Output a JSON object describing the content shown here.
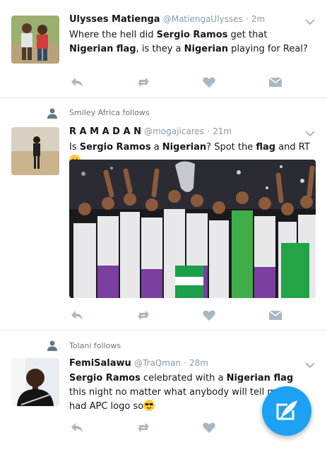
{
  "tweets": [
    {
      "name": "Ulysses Matienga",
      "handle": "@MatiengaUlysses",
      "time": "2m",
      "segments": [
        {
          "t": "Where the hell did ",
          "b": false
        },
        {
          "t": "Sergio Ramos",
          "b": true
        },
        {
          "t": " get that ",
          "b": false
        },
        {
          "t": "Nigerian flag",
          "b": true
        },
        {
          "t": ", is they a ",
          "b": false
        },
        {
          "t": "Nigerian",
          "b": true
        },
        {
          "t": " playing for Real?",
          "b": false
        }
      ]
    },
    {
      "follows": "Smiley Africa follows",
      "name": "R A M A D A N",
      "handle": "@mogajicares",
      "time": "21m",
      "segments": [
        {
          "t": "Is ",
          "b": false
        },
        {
          "t": "Sergio Ramos",
          "b": true
        },
        {
          "t": " a ",
          "b": false
        },
        {
          "t": "Nigerian",
          "b": true
        },
        {
          "t": "? Spot the ",
          "b": false
        },
        {
          "t": "flag",
          "b": true
        },
        {
          "t": " and RT ",
          "b": false
        }
      ],
      "emoji": "smiling-face-emoji"
    },
    {
      "follows": "Tolani follows",
      "name": "FemiSalawu",
      "handle": "@TraQman",
      "time": "28m",
      "segments": [
        {
          "t": "Sergio Ramos",
          "b": true
        },
        {
          "t": " celebrated with a ",
          "b": false
        },
        {
          "t": "Nigerian flag",
          "b": true
        },
        {
          "t": " this night no matter what anybody will tell me. It had APC logo so",
          "b": false
        }
      ],
      "emoji": "sunglasses-emoji"
    }
  ],
  "icons": {
    "reply": "reply-icon",
    "retweet": "retweet-icon",
    "like": "heart-icon",
    "dm": "direct-message-icon",
    "compose": "compose-tweet-icon",
    "menu": "chevron-down-icon"
  },
  "colors": {
    "accent": "#1da1f2",
    "icon_gray": "#aab8c2",
    "separator": "#e1e8ed"
  }
}
